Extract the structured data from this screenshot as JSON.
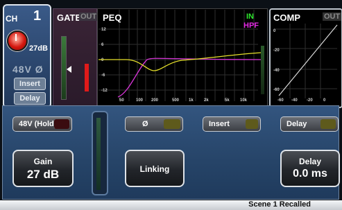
{
  "channel": {
    "label": "CH",
    "number": "1",
    "gain_value": "27dB",
    "phantom_phase": "48V Ø",
    "insert_label": "Insert",
    "delay_label": "Delay"
  },
  "gate": {
    "title": "GATE",
    "out_label": "OUT"
  },
  "peq": {
    "title": "PEQ",
    "in_label": "IN",
    "hpf_label": "HPF",
    "y_ticks": [
      "12",
      "6",
      "0",
      "-6",
      "-12"
    ],
    "x_ticks": [
      "50",
      "100",
      "200",
      "500",
      "1k",
      "2k",
      "5k",
      "10k"
    ],
    "colors": {
      "eq_curve": "#e6e02a",
      "hpf_curve": "#d834d8",
      "in": "#2ee82e",
      "hpf": "#e42ae4"
    }
  },
  "comp": {
    "title": "COMP",
    "out_label": "OUT",
    "y_ticks": [
      "0",
      "-20",
      "-40",
      "-60"
    ],
    "x_ticks": [
      "-60",
      "-40",
      "-20",
      "0"
    ]
  },
  "controls": {
    "phantom_hold_label": "48V (Hold)",
    "phase_label": "Ø",
    "insert_label": "Insert",
    "delay_label": "Delay",
    "gain_title": "Gain",
    "gain_value": "27 dB",
    "linking_label": "Linking",
    "delay_title": "Delay",
    "delay_value": "0.0 ms"
  },
  "status": {
    "text": "Scene 1 Recalled"
  }
}
